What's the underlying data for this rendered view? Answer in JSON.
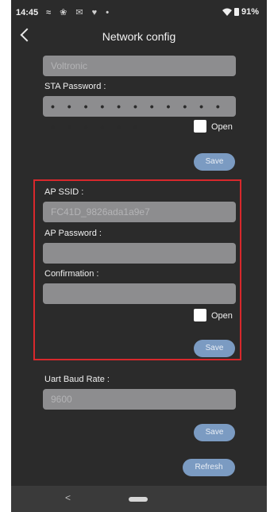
{
  "statusbar": {
    "time": "14:45",
    "icons_text": "≈ ❀ ✉ ♥ •",
    "battery": "91%"
  },
  "header": {
    "title": "Network config"
  },
  "sta": {
    "ssid_value": "Voltronic",
    "password_label": "STA Password :",
    "password_value": "• • • • • • • • • • • • • • • • •",
    "open_label": "Open",
    "save_label": "Save"
  },
  "ap": {
    "ssid_label": "AP SSID :",
    "ssid_placeholder": "FC41D_9826ada1a9e7",
    "password_label": "AP Password :",
    "password_value": "",
    "confirmation_label": "Confirmation :",
    "confirmation_value": "",
    "open_label": "Open",
    "save_label": "Save"
  },
  "uart": {
    "label": "Uart Baud Rate :",
    "placeholder": "9600",
    "save_label": "Save",
    "refresh_label": "Refresh"
  },
  "navbar": {
    "back_symbol": "<"
  },
  "colors": {
    "background": "#2b2b2b",
    "input": "#8d8d8f",
    "button": "#7b9bc2",
    "highlight": "#d8282c"
  }
}
